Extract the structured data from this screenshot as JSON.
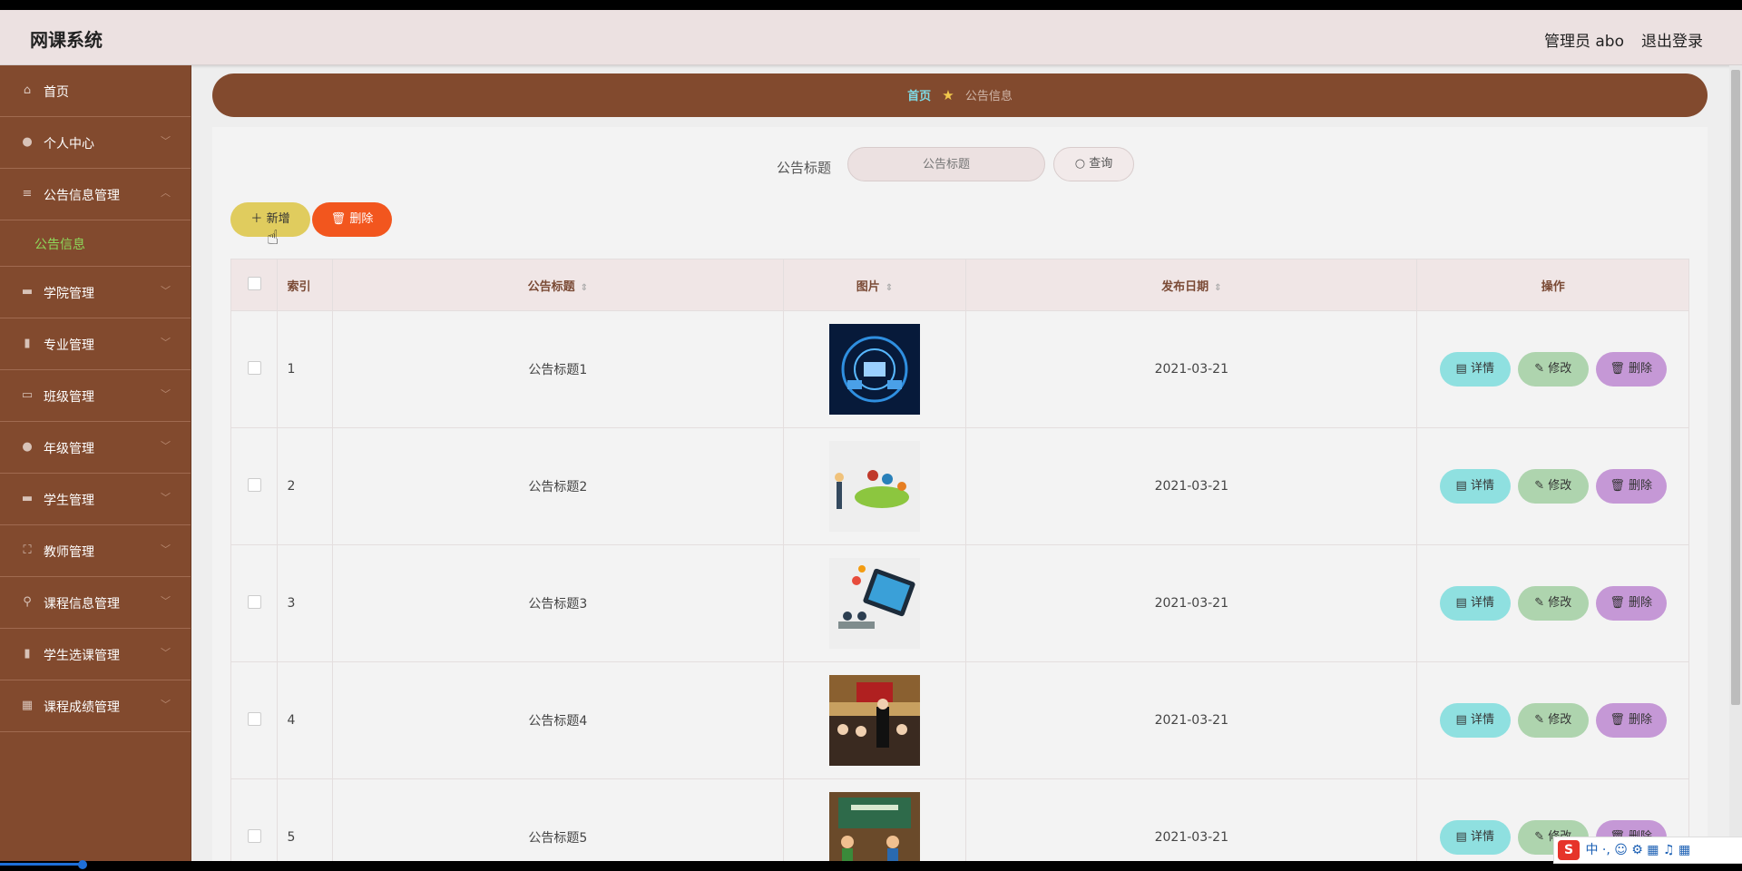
{
  "header": {
    "app_title": "网课系统",
    "admin_label": "管理员 abo",
    "logout_label": "退出登录"
  },
  "sidebar": {
    "items": [
      {
        "label": "首页",
        "icon": "home-icon"
      },
      {
        "label": "个人中心",
        "icon": "user-icon"
      },
      {
        "label": "公告信息管理",
        "icon": "sliders-icon"
      },
      {
        "label": "学院管理",
        "icon": "briefcase-icon"
      },
      {
        "label": "专业管理",
        "icon": "clipboard-icon"
      },
      {
        "label": "班级管理",
        "icon": "monitor-icon"
      },
      {
        "label": "年级管理",
        "icon": "user-icon"
      },
      {
        "label": "学生管理",
        "icon": "chat-icon"
      },
      {
        "label": "教师管理",
        "icon": "frame-icon"
      },
      {
        "label": "课程信息管理",
        "icon": "mic-icon"
      },
      {
        "label": "学生选课管理",
        "icon": "clipboard-check-icon"
      },
      {
        "label": "课程成绩管理",
        "icon": "grid-icon"
      }
    ],
    "submenu_label": "公告信息"
  },
  "breadcrumb": {
    "home": "首页",
    "current": "公告信息"
  },
  "search": {
    "label": "公告标题",
    "placeholder": "公告标题",
    "query_label": "查询"
  },
  "actions": {
    "add_label": "新增",
    "delete_label": "删除"
  },
  "table": {
    "headers": [
      "索引",
      "公告标题",
      "图片",
      "发布日期",
      "操作"
    ],
    "rows": [
      {
        "index": "1",
        "title": "公告标题1",
        "date": "2021-03-21"
      },
      {
        "index": "2",
        "title": "公告标题2",
        "date": "2021-03-21"
      },
      {
        "index": "3",
        "title": "公告标题3",
        "date": "2021-03-21"
      },
      {
        "index": "4",
        "title": "公告标题4",
        "date": "2021-03-21"
      },
      {
        "index": "5",
        "title": "公告标题5",
        "date": "2021-03-21"
      }
    ],
    "op_labels": {
      "detail": "详情",
      "edit": "修改",
      "delete": "删除"
    }
  },
  "ime": {
    "text": "中"
  },
  "colors": {
    "sidebar_bg": "#824a2e",
    "header_bg": "#ece1e1",
    "add_btn": "#e0cc5e",
    "delete_btn": "#f2561e",
    "detail_btn": "#8fe0e0",
    "edit_btn": "#aed4ae",
    "row_delete_btn": "#c598d6"
  }
}
